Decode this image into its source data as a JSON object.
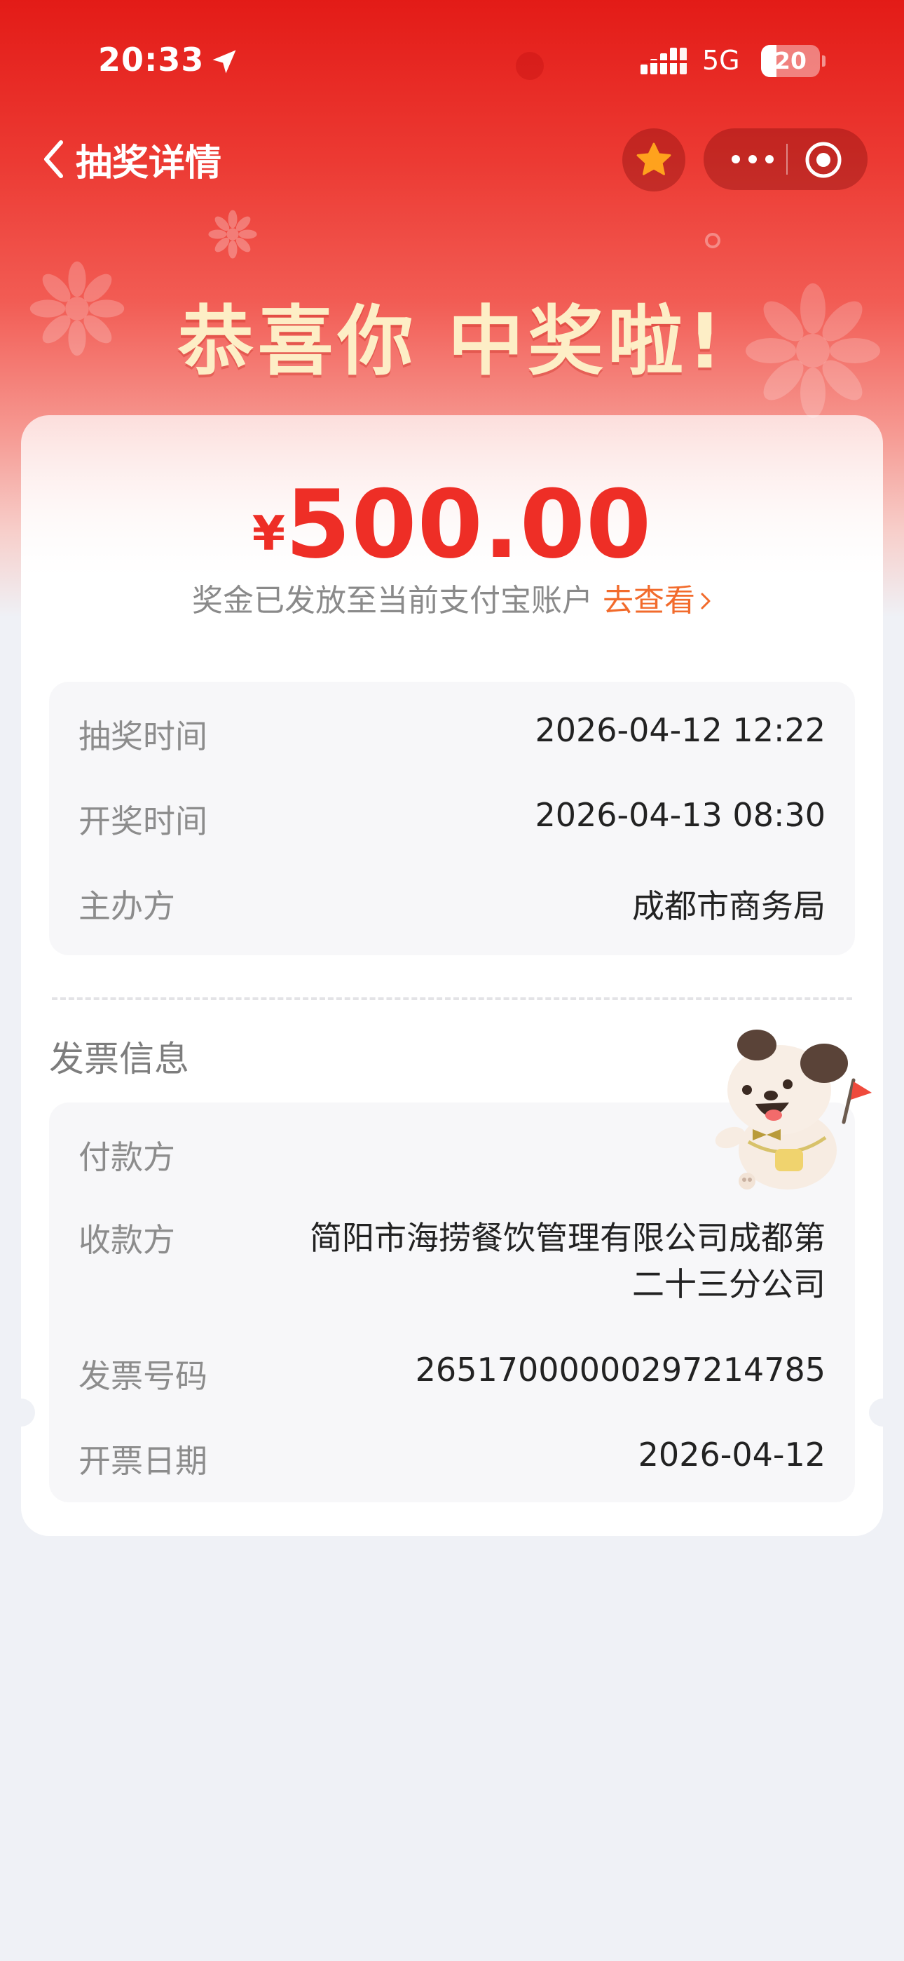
{
  "status_bar": {
    "time": "20:33",
    "network": "5G",
    "battery": "20"
  },
  "nav": {
    "title": "抽奖详情",
    "back_icon": "chevron-left-icon",
    "favorite_icon": "star-icon",
    "more_icon": "more-dots-icon",
    "close_icon": "target-circle-icon"
  },
  "header": {
    "congrats": "恭喜你 中奖啦!"
  },
  "prize": {
    "currency": "¥",
    "amount": "500.00",
    "payout_text": "奖金已发放至当前支付宝账户",
    "view_link": "去查看"
  },
  "lottery_info": {
    "rows": [
      {
        "label": "抽奖时间",
        "value": "2026-04-12 12:22"
      },
      {
        "label": "开奖时间",
        "value": "2026-04-13 08:30"
      },
      {
        "label": "主办方",
        "value": "成都市商务局"
      }
    ]
  },
  "invoice": {
    "title": "发票信息",
    "payer_label": "付款方",
    "payer_value": "",
    "payee_label": "收款方",
    "payee_value": "简阳市海捞餐饮管理有限公司成都第二十三分公司",
    "number_label": "发票号码",
    "number_value": "26517000000297214785",
    "date_label": "开票日期",
    "date_value": "2026-04-12"
  },
  "colors": {
    "brand_red": "#e31b17",
    "amount_red": "#ee2e26",
    "link_orange": "#f26b2c",
    "congrats_cream": "#fdeec6",
    "page_bg": "#eff1f6"
  }
}
